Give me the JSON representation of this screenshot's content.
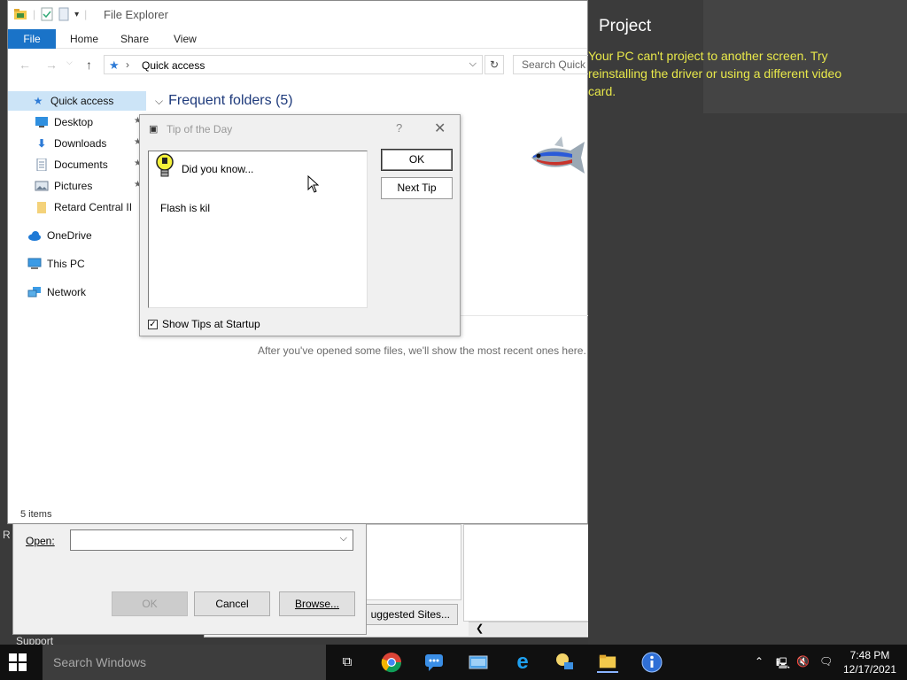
{
  "desktop": {
    "edge_text_1": "R",
    "edge_text_2": "Support"
  },
  "run_dialog": {
    "open_label": "Open:",
    "open_value": "",
    "ok_label": "OK",
    "cancel_label": "Cancel",
    "browse_label": "Browse..."
  },
  "ie_window": {
    "suggested_sites_label": "uggested Sites..."
  },
  "explorer": {
    "title": "File Explorer",
    "tabs": {
      "file": "File",
      "home": "Home",
      "share": "Share",
      "view": "View"
    },
    "address": "Quick access",
    "search_placeholder": "Search Quick access",
    "nav": {
      "quick_access": "Quick access",
      "desktop": "Desktop",
      "downloads": "Downloads",
      "documents": "Documents",
      "pictures": "Pictures",
      "retard": "Retard Central II",
      "onedrive": "OneDrive",
      "thispc": "This PC",
      "network": "Network"
    },
    "frequent_folders": "Frequent folders (5)",
    "recent_message": "After you've opened some files, we'll show the most recent ones here.",
    "status": "5 items"
  },
  "tip_dialog": {
    "title": "Tip of the Day",
    "help_glyph": "?",
    "close_glyph": "✕",
    "did_you_know": "Did you know...",
    "tip_text": "Flash is kil",
    "ok_label": "OK",
    "next_tip_label": "Next Tip",
    "show_tips_label": "Show Tips at Startup",
    "show_tips_checked": true
  },
  "project_panel": {
    "title": "Project",
    "message": "Your PC can't project to another screen. Try reinstalling the driver or using a different video card."
  },
  "taskbar": {
    "search_placeholder": "Search Windows",
    "time": "7:48 PM",
    "date": "12/17/2021"
  },
  "colors": {
    "file_tab": "#1a73c8",
    "warning_text": "#e8e84a",
    "taskbar": "#101010",
    "flyout": "#3b3b3b"
  }
}
